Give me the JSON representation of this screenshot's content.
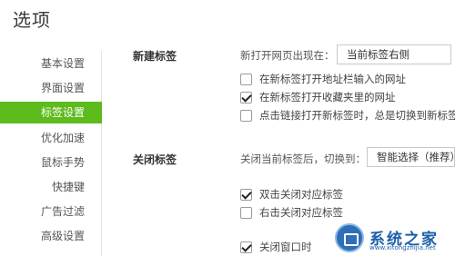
{
  "page": {
    "title": "选项"
  },
  "sidebar": {
    "items": [
      {
        "label": "基本设置"
      },
      {
        "label": "界面设置"
      },
      {
        "label": "标签设置"
      },
      {
        "label": "优化加速"
      },
      {
        "label": "鼠标手势"
      },
      {
        "label": "快捷键"
      },
      {
        "label": "广告过滤"
      },
      {
        "label": "高级设置"
      }
    ],
    "active_index": 2,
    "active_color": "#5dbb1c"
  },
  "new_tab": {
    "title": "新建标签",
    "open_at_label": "新打开网页出现在：",
    "open_at_value": "当前标签右侧",
    "options": [
      {
        "label": "在新标签打开地址栏输入的网址",
        "checked": false
      },
      {
        "label": "在新标签打开收藏夹里的网址",
        "checked": true
      },
      {
        "label": "点击链接打开新标签时，总是切换到新标签页",
        "checked": false
      }
    ]
  },
  "close_tab": {
    "title": "关闭标签",
    "switch_label": "关闭当前标签后，切换到：",
    "switch_value": "智能选择（推荐）",
    "options": [
      {
        "label": "双击关闭对应标签",
        "checked": true
      },
      {
        "label": "右击关闭对应标签",
        "checked": false
      },
      {
        "label": "关闭窗口时",
        "checked": true
      }
    ]
  },
  "watermark": {
    "text": "系统之家",
    "url": "www.xitongzhijia.net",
    "icon": "monitor-logo-icon"
  }
}
